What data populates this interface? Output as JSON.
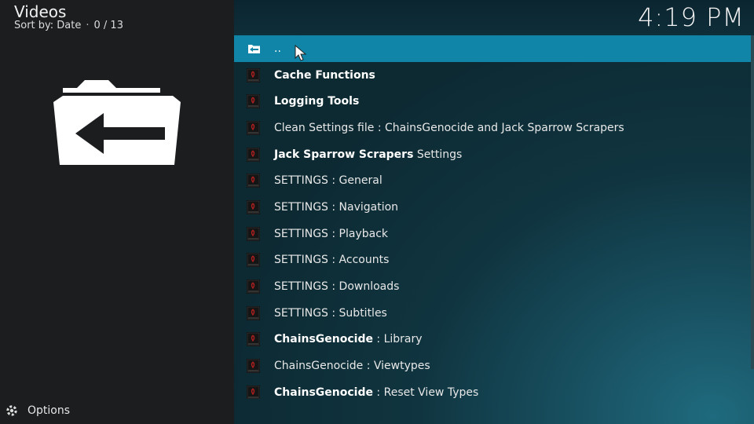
{
  "header": {
    "title": "Videos",
    "sort_label": "Sort by: Date",
    "sort_separator": "·",
    "count": "0 / 13"
  },
  "clock": "4:19 PM",
  "footer": {
    "options_label": "Options",
    "options_icon": "gear-icon"
  },
  "list": {
    "parent_label": "..",
    "items": [
      {
        "bold": "Cache Functions",
        "rest": ""
      },
      {
        "bold": "Logging Tools",
        "rest": ""
      },
      {
        "bold": "",
        "rest": "Clean Settings file : ChainsGenocide and Jack Sparrow Scrapers"
      },
      {
        "bold": "Jack Sparrow Scrapers",
        "rest": " Settings"
      },
      {
        "bold": "",
        "rest": "SETTINGS : General"
      },
      {
        "bold": "",
        "rest": "SETTINGS : Navigation"
      },
      {
        "bold": "",
        "rest": "SETTINGS : Playback"
      },
      {
        "bold": "",
        "rest": "SETTINGS : Accounts"
      },
      {
        "bold": "",
        "rest": "SETTINGS : Downloads"
      },
      {
        "bold": "",
        "rest": "SETTINGS : Subtitles"
      },
      {
        "bold": "ChainsGenocide",
        "rest": " : Library"
      },
      {
        "bold": "",
        "rest": "ChainsGenocide : Viewtypes"
      },
      {
        "bold": "ChainsGenocide",
        "rest": " : Reset View Types"
      }
    ]
  },
  "colors": {
    "selected": "#1185a8",
    "left_bg": "#1b1d1e"
  }
}
